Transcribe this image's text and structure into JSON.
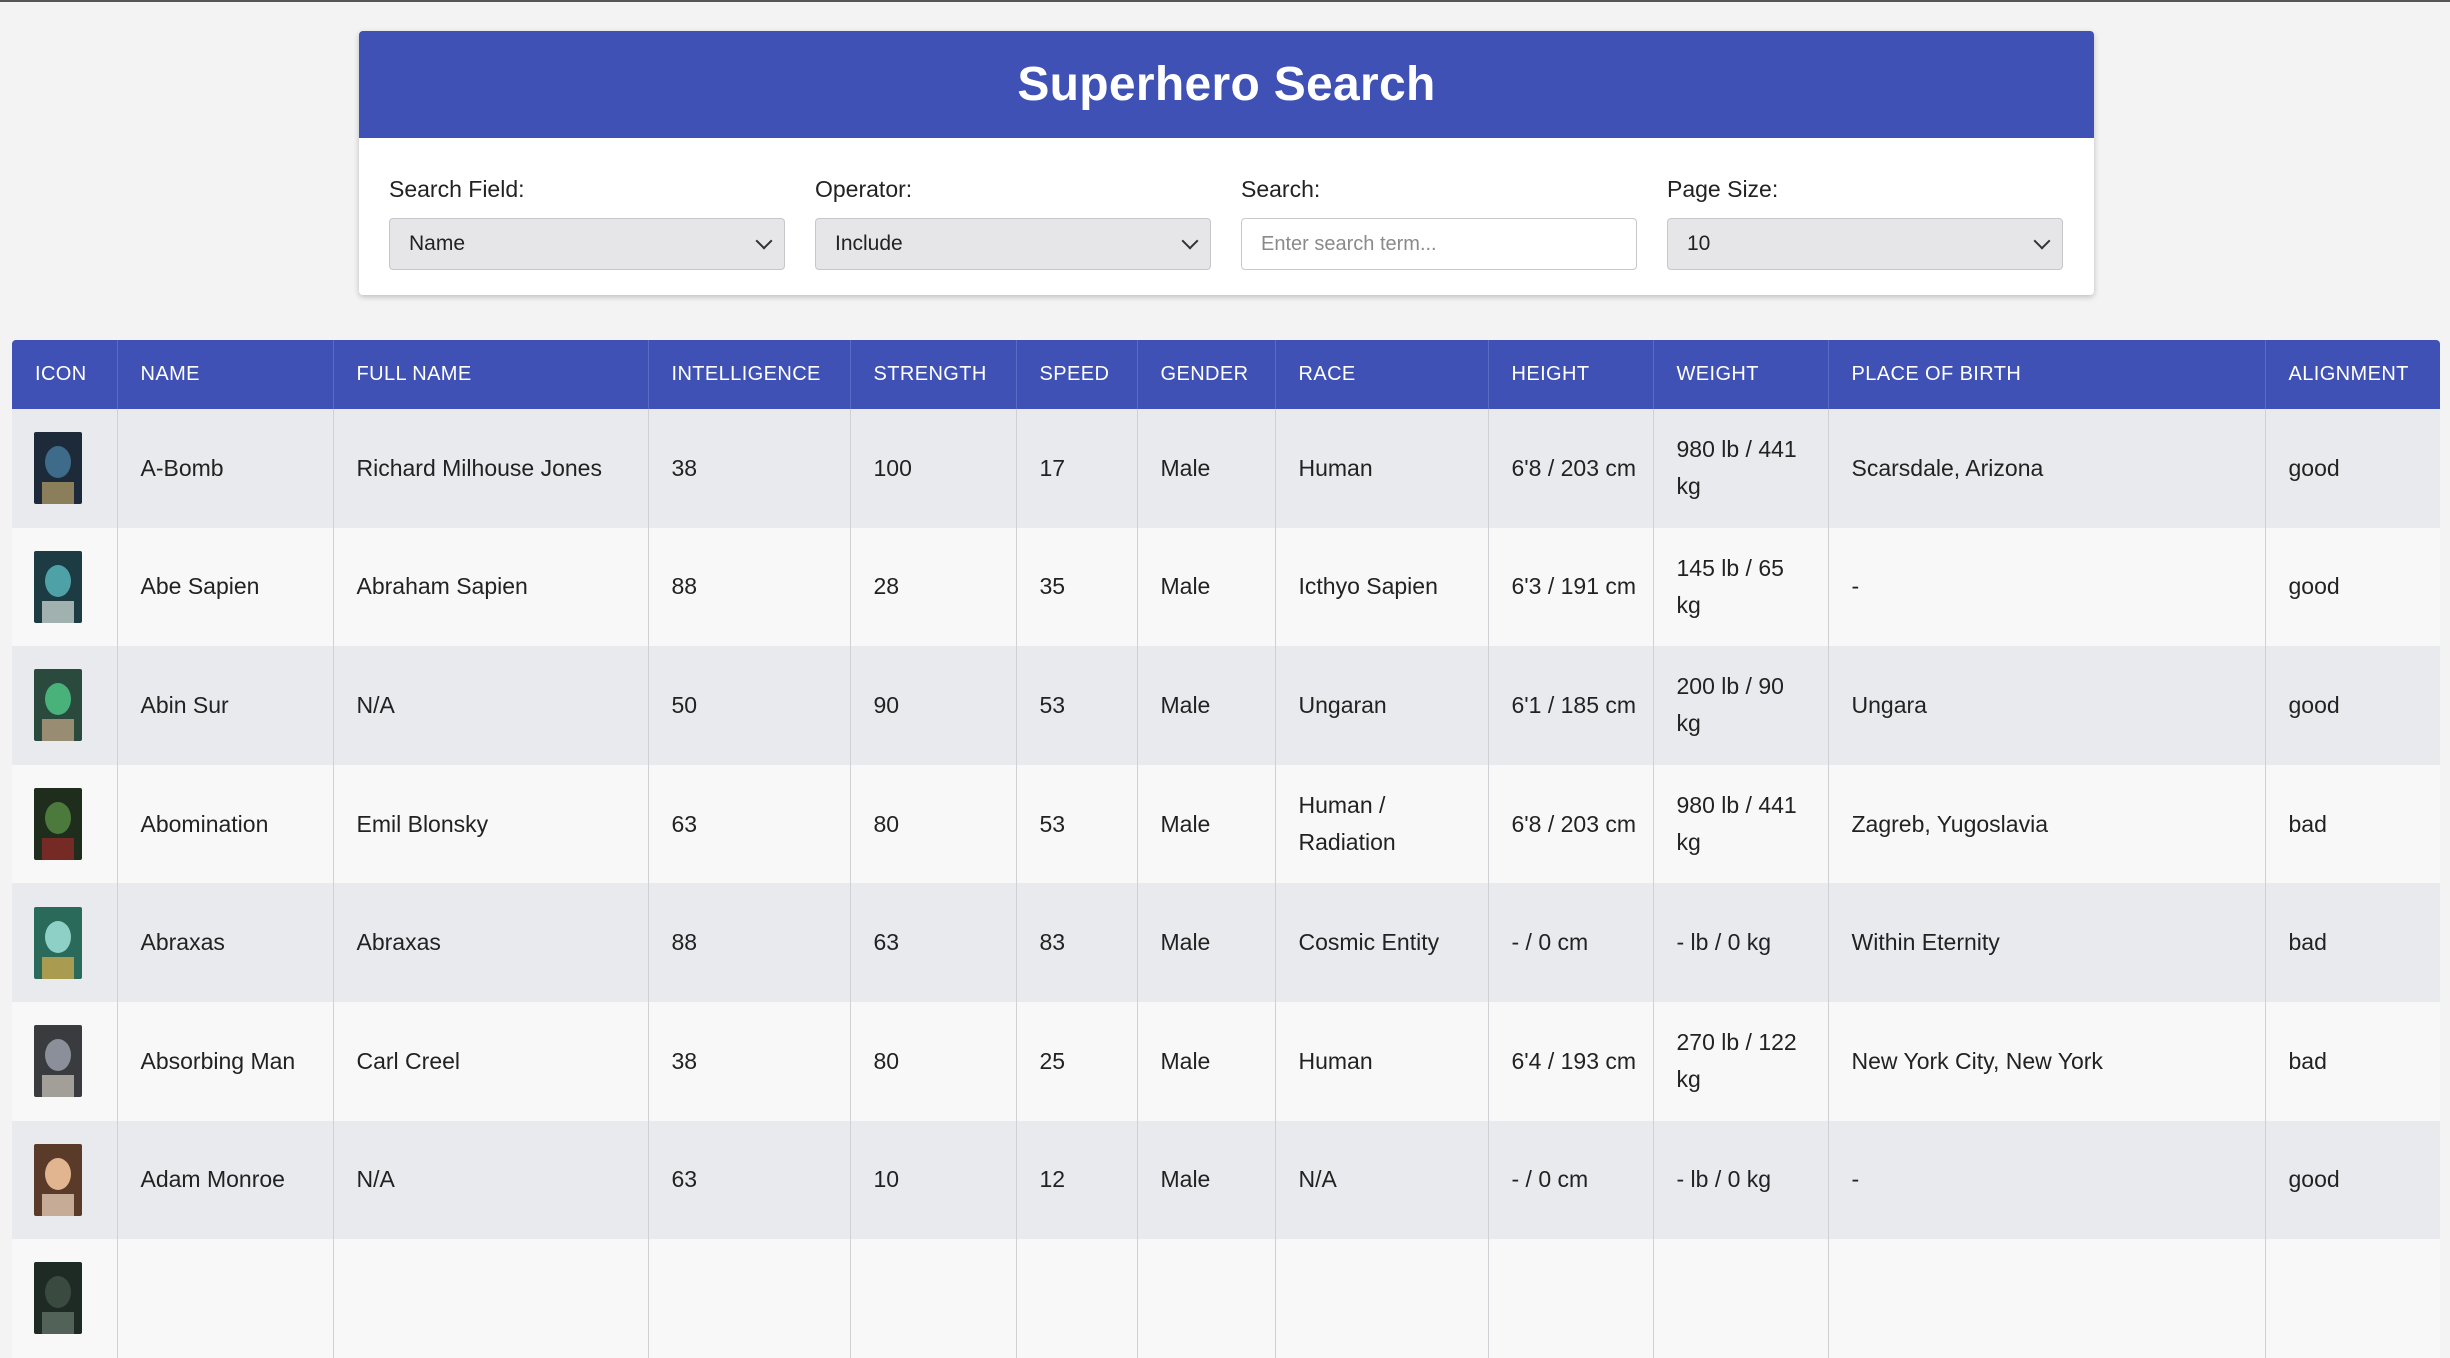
{
  "app": {
    "title": "Superhero Search"
  },
  "search": {
    "field_label": "Search Field:",
    "field_value": "Name",
    "operator_label": "Operator:",
    "operator_value": "Include",
    "search_label": "Search:",
    "search_placeholder": "Enter search term...",
    "search_value": "",
    "page_size_label": "Page Size:",
    "page_size_value": "10"
  },
  "colors": {
    "primary": "#3f51b5",
    "row_odd": "#e8eaed",
    "row_even": "#f8f8f8"
  },
  "table": {
    "columns": [
      "ICON",
      "NAME",
      "FULL NAME",
      "INTELLIGENCE",
      "STRENGTH",
      "SPEED",
      "GENDER",
      "RACE",
      "HEIGHT",
      "WEIGHT",
      "PLACE OF BIRTH",
      "ALIGNMENT"
    ],
    "rows": [
      {
        "icon": "hero-thumbnail",
        "name": "A-Bomb",
        "full_name": "Richard Milhouse Jones",
        "intelligence": "38",
        "strength": "100",
        "speed": "17",
        "gender": "Male",
        "race": "Human",
        "height": "6'8 / 203 cm",
        "weight": "980 lb / 441 kg",
        "place_of_birth": "Scarsdale, Arizona",
        "alignment": "good"
      },
      {
        "icon": "hero-thumbnail",
        "name": "Abe Sapien",
        "full_name": "Abraham Sapien",
        "intelligence": "88",
        "strength": "28",
        "speed": "35",
        "gender": "Male",
        "race": "Icthyo Sapien",
        "height": "6'3 / 191 cm",
        "weight": "145 lb / 65 kg",
        "place_of_birth": "-",
        "alignment": "good"
      },
      {
        "icon": "hero-thumbnail",
        "name": "Abin Sur",
        "full_name": "N/A",
        "intelligence": "50",
        "strength": "90",
        "speed": "53",
        "gender": "Male",
        "race": "Ungaran",
        "height": "6'1 / 185 cm",
        "weight": "200 lb / 90 kg",
        "place_of_birth": "Ungara",
        "alignment": "good"
      },
      {
        "icon": "hero-thumbnail",
        "name": "Abomination",
        "full_name": "Emil Blonsky",
        "intelligence": "63",
        "strength": "80",
        "speed": "53",
        "gender": "Male",
        "race": "Human / Radiation",
        "height": "6'8 / 203 cm",
        "weight": "980 lb / 441 kg",
        "place_of_birth": "Zagreb, Yugoslavia",
        "alignment": "bad"
      },
      {
        "icon": "hero-thumbnail",
        "name": "Abraxas",
        "full_name": "Abraxas",
        "intelligence": "88",
        "strength": "63",
        "speed": "83",
        "gender": "Male",
        "race": "Cosmic Entity",
        "height": "- / 0 cm",
        "weight": "- lb / 0 kg",
        "place_of_birth": "Within Eternity",
        "alignment": "bad"
      },
      {
        "icon": "hero-thumbnail",
        "name": "Absorbing Man",
        "full_name": "Carl Creel",
        "intelligence": "38",
        "strength": "80",
        "speed": "25",
        "gender": "Male",
        "race": "Human",
        "height": "6'4 / 193 cm",
        "weight": "270 lb / 122 kg",
        "place_of_birth": "New York City, New York",
        "alignment": "bad"
      },
      {
        "icon": "hero-thumbnail",
        "name": "Adam Monroe",
        "full_name": "N/A",
        "intelligence": "63",
        "strength": "10",
        "speed": "12",
        "gender": "Male",
        "race": "N/A",
        "height": "- / 0 cm",
        "weight": "- lb / 0 kg",
        "place_of_birth": "-",
        "alignment": "good"
      },
      {
        "icon": "hero-thumbnail",
        "name": "",
        "full_name": "",
        "intelligence": "",
        "strength": "",
        "speed": "",
        "gender": "",
        "race": "",
        "height": "",
        "weight": "",
        "place_of_birth": "",
        "alignment": ""
      }
    ]
  }
}
